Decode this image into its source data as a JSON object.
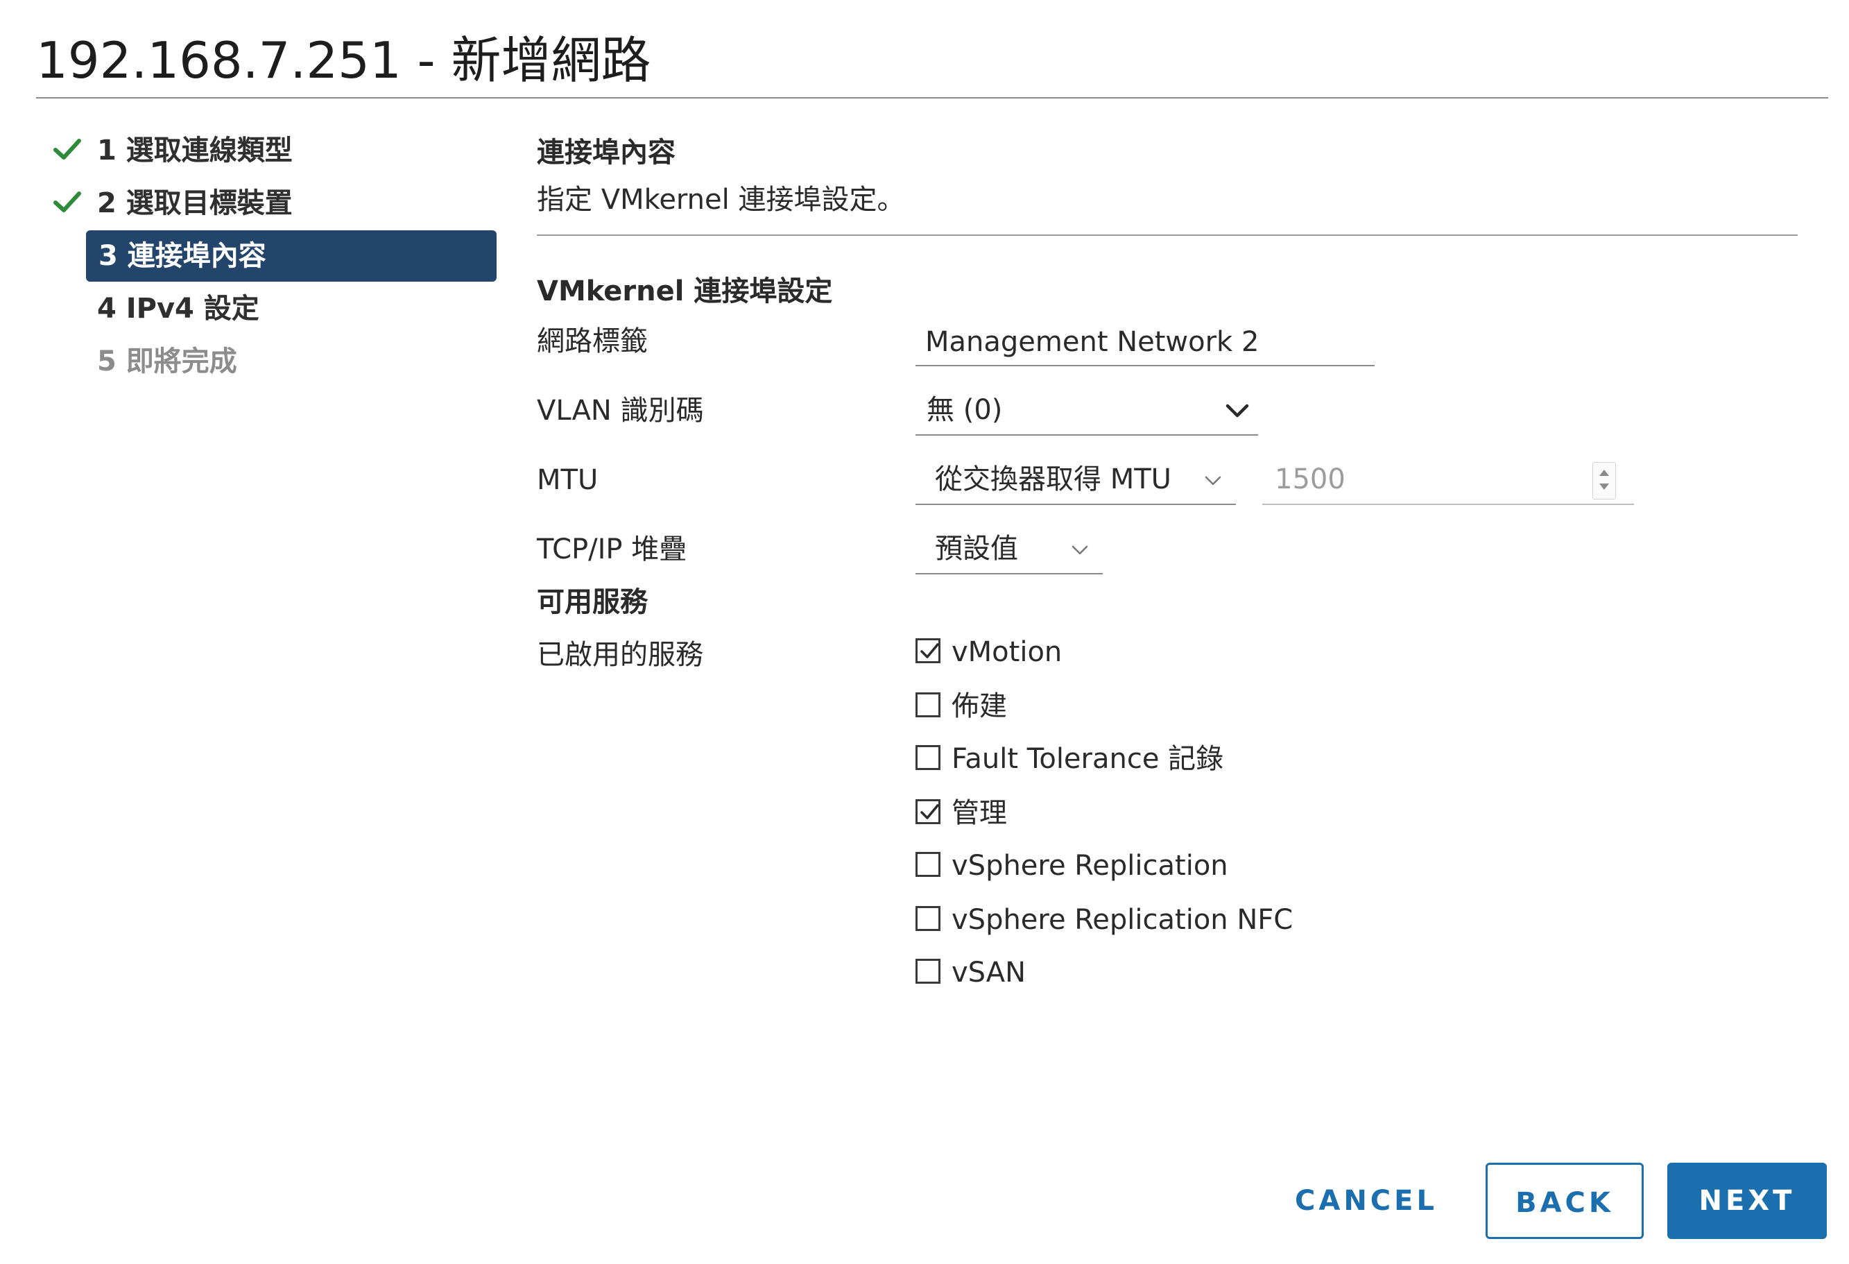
{
  "dialog": {
    "title": "192.168.7.251 - 新增網路"
  },
  "steps": [
    {
      "label": "1 選取連線類型",
      "state": "completed"
    },
    {
      "label": "2 選取目標裝置",
      "state": "completed"
    },
    {
      "label": "3 連接埠內容",
      "state": "active"
    },
    {
      "label": "4 IPv4 設定",
      "state": "pending"
    },
    {
      "label": "5 即將完成",
      "state": "future"
    }
  ],
  "content": {
    "section_title": "連接埠內容",
    "section_desc": "指定 VMkernel 連接埠設定。",
    "settings_title": "VMkernel 連接埠設定",
    "network_label": {
      "label": "網路標籤",
      "value": "Management Network 2"
    },
    "vlan": {
      "label": "VLAN 識別碼",
      "value": "無 (0)"
    },
    "mtu": {
      "label": "MTU",
      "mode": "從交換器取得 MTU",
      "value": "1500"
    },
    "tcpip": {
      "label": "TCP/IP 堆疊",
      "value": "預設值"
    },
    "services_title": "可用服務",
    "enabled_services_label": "已啟用的服務",
    "services": [
      {
        "label": "vMotion",
        "checked": true
      },
      {
        "label": "佈建",
        "checked": false
      },
      {
        "label": "Fault Tolerance 記錄",
        "checked": false
      },
      {
        "label": "管理",
        "checked": true
      },
      {
        "label": "vSphere Replication",
        "checked": false
      },
      {
        "label": "vSphere Replication NFC",
        "checked": false
      },
      {
        "label": "vSAN",
        "checked": false
      }
    ]
  },
  "buttons": {
    "cancel": "CANCEL",
    "back": "BACK",
    "next": "NEXT"
  },
  "colors": {
    "accent": "#1b6fae",
    "active_step": "#24456b",
    "check_green": "#2e8b3a"
  },
  "icons": {
    "step_done": "checkmark-icon",
    "dropdown": "chevron-down-icon",
    "spinner": "spinner-arrows-icon",
    "checkbox_checked": "checkbox-checked-icon",
    "checkbox_unchecked": "checkbox-unchecked-icon"
  }
}
